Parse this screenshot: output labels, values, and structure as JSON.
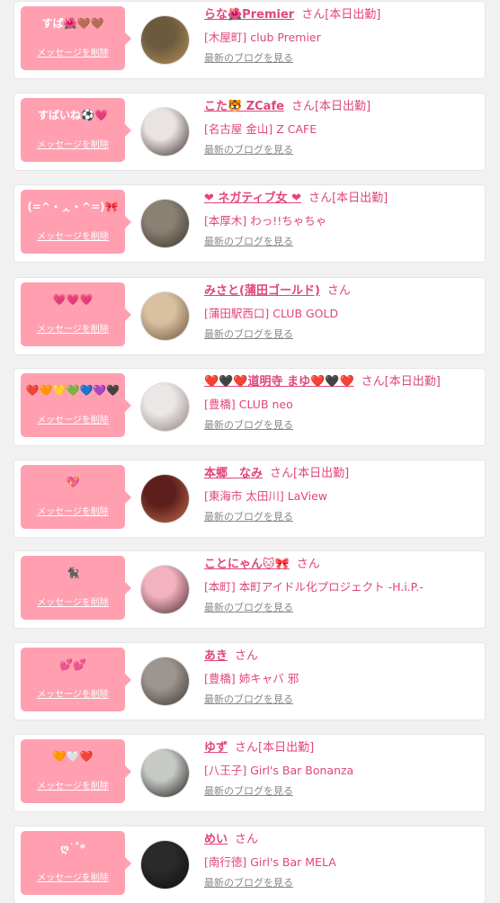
{
  "colors": {
    "accent": "#e0457b",
    "bubble": "#ff9fb0",
    "background": "#f1f1f1"
  },
  "items": [
    {
      "message": "すば🌺🤎🤎",
      "delete_label": "メッセージを削除",
      "name": "らな🌺Premier",
      "suffix": "さん[本日出勤]",
      "shop": "[木屋町] club Premier",
      "blog_link": "最新のブログを見る",
      "avatar_bg": [
        "#6b5a3d",
        "#b58f5a"
      ]
    },
    {
      "message": "すばいね⚽💗",
      "delete_label": "メッセージを削除",
      "name": "こた🐯 ZCafe",
      "suffix": "さん[本日出勤]",
      "shop": "[名古屋 金山] Z CAFE",
      "blog_link": "最新のブログを見る",
      "avatar_bg": [
        "#e9e4e2",
        "#3a2d2a"
      ]
    },
    {
      "message": "(=^・ᆺ・^=)🎀",
      "delete_label": "メッセージを削除",
      "name": "❤ ネガティブ女 ❤",
      "suffix": "さん[本日出勤]",
      "shop": "[本厚木] わっ!!ちゃちゃ",
      "blog_link": "最新のブログを見る",
      "avatar_bg": [
        "#8a8172",
        "#3b342c"
      ]
    },
    {
      "message": "💗💗💗",
      "delete_label": "メッセージを削除",
      "name": "みさと(蒲田ゴールド)",
      "suffix": "さん",
      "shop": "[蒲田駅西口] CLUB GOLD",
      "blog_link": "最新のブログを見る",
      "avatar_bg": [
        "#d9c0a1",
        "#6e5139"
      ]
    },
    {
      "message": "❤️🧡💛💚💙💜🖤",
      "delete_label": "メッセージを削除",
      "name": "❤️🖤❤️道明寺 まゆ❤️🖤❤️",
      "suffix": "さん[本日出勤]",
      "shop": "[豊橋] CLUB neo",
      "blog_link": "最新のブログを見る",
      "avatar_bg": [
        "#ebe7e6",
        "#8e7f7a"
      ]
    },
    {
      "message": "💖",
      "delete_label": "メッセージを削除",
      "name": "本郷　なみ",
      "suffix": "さん[本日出勤]",
      "shop": "[東海市 太田川] LaView",
      "blog_link": "最新のブログを見る",
      "avatar_bg": [
        "#5d1f1c",
        "#c46b4e"
      ]
    },
    {
      "message": "🐈‍⬛",
      "delete_label": "メッセージを削除",
      "name": "ことにゃん🐱🎀",
      "suffix": "さん",
      "shop": "[本町] 本町アイドル化プロジェクト -H.i.P.-",
      "blog_link": "最新のブログを見る",
      "avatar_bg": [
        "#f2b2c0",
        "#4a2a2d"
      ]
    },
    {
      "message": "💕💕",
      "delete_label": "メッセージを削除",
      "name": "あき",
      "suffix": "さん",
      "shop": "[豊橋] 姉キャバ 邪",
      "blog_link": "最新のブログを見る",
      "avatar_bg": [
        "#9d958f",
        "#3c3835"
      ]
    },
    {
      "message": "🧡🤍❤️",
      "delete_label": "メッセージを削除",
      "name": "ゆず",
      "suffix": "さん[本日出勤]",
      "shop": "[八王子] Girl's Bar Bonanza",
      "blog_link": "最新のブログを見る",
      "avatar_bg": [
        "#c6c9c4",
        "#1a1b1a"
      ]
    },
    {
      "message": "ღ˙˚*",
      "delete_label": "メッセージを削除",
      "name": "めい",
      "suffix": "さん",
      "shop": "[南行徳] Girl's Bar MELA",
      "blog_link": "最新のブログを見る",
      "avatar_bg": [
        "#2a2a2a",
        "#0d0d0d"
      ]
    }
  ]
}
